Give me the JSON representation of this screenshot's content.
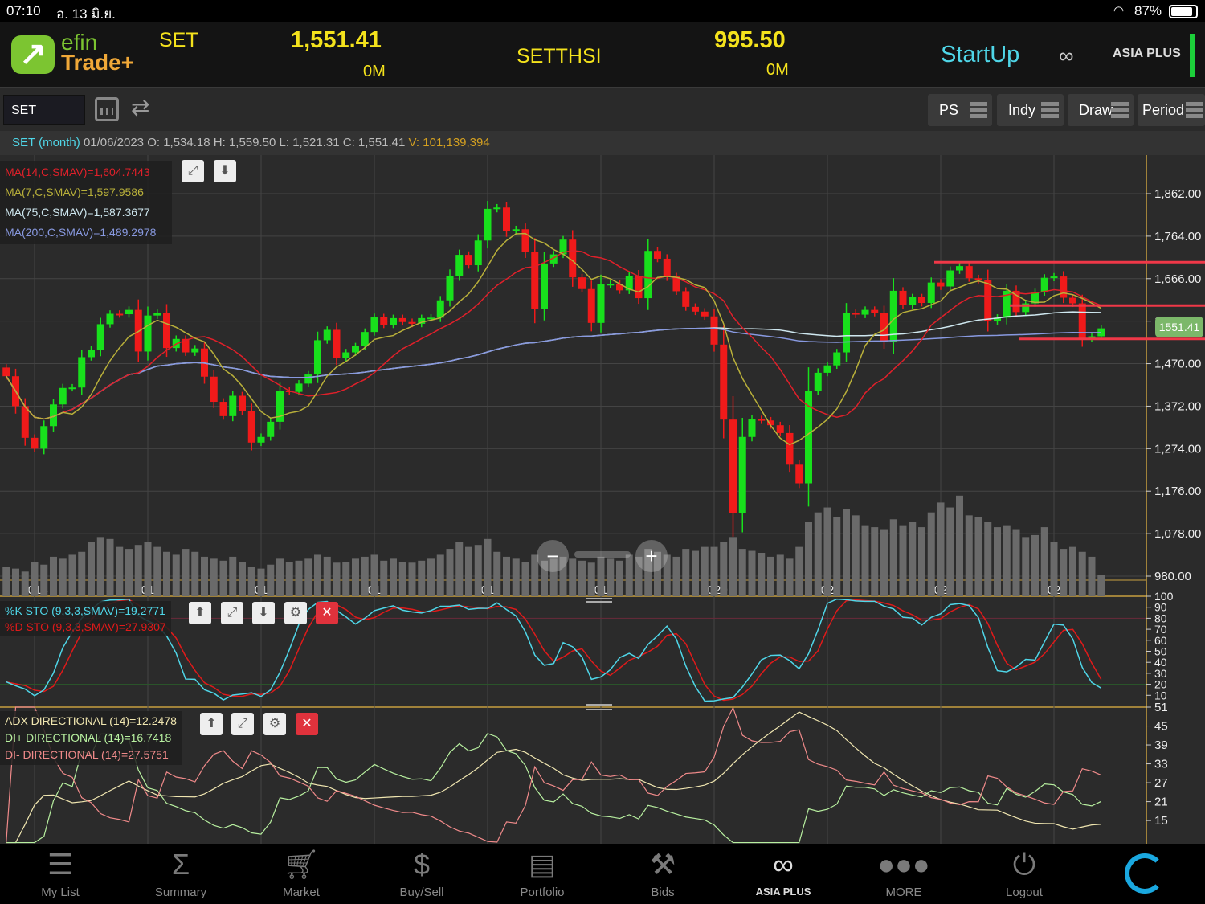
{
  "status": {
    "time": "07:10",
    "date": "อ. 13 มิ.ย.",
    "battery": "87%"
  },
  "header": {
    "logo_top": "efin",
    "logo_bottom": "Trade+",
    "index1": {
      "name": "SET",
      "value": "1,551.41",
      "volume": "0M"
    },
    "index2": {
      "name": "SETTHSI",
      "value": "995.50",
      "volume": "0M"
    },
    "startup": "StartUp",
    "broker": "ASIA PLUS"
  },
  "toolbar": {
    "symbol": "SET",
    "buttons": [
      "PS",
      "Indy",
      "Draw",
      "Period"
    ]
  },
  "info": {
    "symbol": "SET",
    "period": "(month)",
    "date": "01/06/2023",
    "o_label": "O:",
    "o": "1,534.18",
    "h_label": "H:",
    "h": "1,559.50",
    "l_label": "L:",
    "l": "1,521.31",
    "c_label": "C:",
    "c": "1,551.41",
    "v_label": "V:",
    "v": "101,139,394"
  },
  "legend": {
    "ma14": "MA(14,C,SMAV)=1,604.7443",
    "ma7": "MA(7,C,SMAV)=1,597.9586",
    "ma75": "MA(75,C,SMAV)=1,587.3677",
    "ma200": "MA(200,C,SMAV)=1,489.2978"
  },
  "stoch_legend": {
    "k": "%K STO (9,3,3,SMAV)=19.2771",
    "d": "%D STO (9,3,3,SMAV)=27.9307"
  },
  "adx_legend": {
    "adx": "ADX DIRECTIONAL (14)=12.2478",
    "dip": "DI+ DIRECTIONAL (14)=16.7418",
    "dim": "DI- DIRECTIONAL (14)=27.5751"
  },
  "last_price_tag": "1551.41",
  "colors": {
    "up": "#18e01c",
    "down": "#f01a1a",
    "ma14": "#e0202a",
    "ma7": "#b9b03a",
    "ma75": "#cfe8f0",
    "ma200": "#8899e0",
    "stoch_k": "#4fd6e8",
    "stoch_d": "#e01a1a",
    "adx": "#f0e6b0",
    "dip": "#b8f0a0",
    "dim": "#f08a8a",
    "accent": "#4fd6e8",
    "yellow": "#f4e21c"
  },
  "nav": [
    "My List",
    "Summary",
    "Market",
    "Buy/Sell",
    "Portfolio",
    "Bids",
    "ASIA PLUS",
    "MORE",
    "Logout"
  ],
  "chart_data": {
    "type": "candlestick",
    "start": "2013-10",
    "interval": "month",
    "year_labels": [
      "2014",
      "2015",
      "2016",
      "2017",
      "2018",
      "2019",
      "2020",
      "2021",
      "2022",
      "2023"
    ],
    "price_ticks": [
      "1,862.00",
      "1,764.00",
      "1,666.00",
      "1,568.00",
      "1,470.00",
      "1,372.00",
      "1,274.00",
      "1,176.00",
      "1,078.00",
      "980.00"
    ],
    "price_tick_values": [
      1862,
      1764,
      1666,
      1568,
      1470,
      1372,
      1274,
      1176,
      1078,
      980
    ],
    "ylim": [
      980,
      1862
    ],
    "close": [
      1441,
      1372,
      1299,
      1274,
      1326,
      1376,
      1414,
      1415,
      1485,
      1502,
      1561,
      1585,
      1584,
      1594,
      1498,
      1581,
      1587,
      1506,
      1527,
      1496,
      1505,
      1440,
      1382,
      1349,
      1396,
      1360,
      1288,
      1301,
      1336,
      1408,
      1405,
      1424,
      1445,
      1524,
      1548,
      1483,
      1496,
      1510,
      1543,
      1577,
      1560,
      1575,
      1566,
      1562,
      1575,
      1576,
      1616,
      1673,
      1721,
      1697,
      1754,
      1827,
      1830,
      1776,
      1780,
      1727,
      1596,
      1701,
      1722,
      1756,
      1669,
      1642,
      1564,
      1653,
      1654,
      1639,
      1673,
      1621,
      1730,
      1712,
      1671,
      1637,
      1601,
      1590,
      1579,
      1514,
      1341,
      1125,
      1301,
      1342,
      1339,
      1328,
      1310,
      1237,
      1194,
      1408,
      1449,
      1466,
      1496,
      1587,
      1583,
      1594,
      1587,
      1521,
      1638,
      1605,
      1623,
      1610,
      1657,
      1648,
      1685,
      1695,
      1667,
      1663,
      1568,
      1576,
      1638,
      1589,
      1609,
      1635,
      1668,
      1671,
      1622,
      1609,
      1529,
      1533,
      1551.41
    ],
    "volume": [
      30,
      28,
      25,
      35,
      32,
      40,
      38,
      42,
      45,
      55,
      60,
      58,
      50,
      48,
      52,
      55,
      50,
      45,
      42,
      48,
      45,
      40,
      38,
      36,
      40,
      35,
      30,
      28,
      32,
      38,
      35,
      36,
      38,
      42,
      40,
      34,
      35,
      38,
      40,
      42,
      36,
      38,
      35,
      34,
      36,
      38,
      42,
      48,
      55,
      50,
      52,
      58,
      45,
      40,
      38,
      35,
      42,
      36,
      38,
      40,
      38,
      36,
      34,
      40,
      38,
      36,
      42,
      40,
      48,
      45,
      42,
      40,
      48,
      46,
      50,
      50,
      55,
      60,
      48,
      46,
      44,
      40,
      42,
      38,
      50,
      75,
      85,
      90,
      80,
      88,
      82,
      72,
      70,
      68,
      78,
      72,
      75,
      70,
      85,
      95,
      90,
      102,
      82,
      80,
      75,
      70,
      72,
      68,
      60,
      62,
      70,
      55,
      48,
      50,
      45,
      40,
      22
    ],
    "volume_max": 110,
    "support_lines": [
      {
        "price": 1704,
        "from": "2022-01"
      },
      {
        "price": 1604,
        "from": "2022-09"
      },
      {
        "price": 1527,
        "from": "2022-10"
      }
    ],
    "stoch_ticks": [
      100,
      90,
      80,
      70,
      60,
      50,
      40,
      30,
      20,
      10
    ],
    "adx_ticks": [
      51,
      45,
      39,
      33,
      27,
      21,
      15
    ]
  }
}
